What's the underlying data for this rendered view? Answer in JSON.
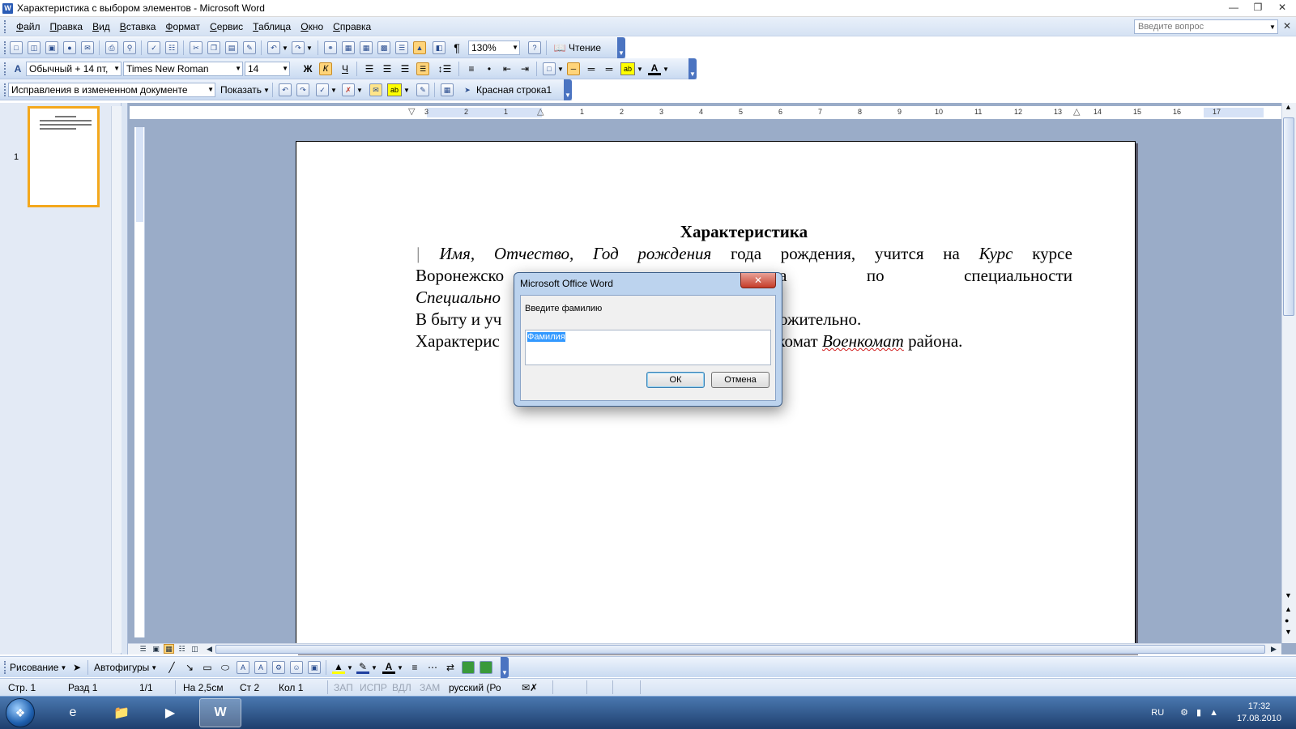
{
  "window": {
    "title": "Характеристика с выбором элементов - Microsoft Word",
    "app_icon": "word-icon"
  },
  "menu": {
    "items": [
      "Файл",
      "Правка",
      "Вид",
      "Вставка",
      "Формат",
      "Сервис",
      "Таблица",
      "Окно",
      "Справка"
    ],
    "ask_placeholder": "Введите вопрос"
  },
  "standard_toolbar": {
    "zoom": "130%",
    "reading_label": "Чтение"
  },
  "formatting_toolbar": {
    "style": "Обычный + 14 пт,",
    "font": "Times New Roman",
    "size": "14"
  },
  "review_toolbar": {
    "mode": "Исправления в измененном документе",
    "show_label": "Показать",
    "style_label": "Красная строка1"
  },
  "ruler": {
    "numbers": [
      "3",
      "2",
      "1",
      "1",
      "2",
      "3",
      "4",
      "5",
      "6",
      "7",
      "8",
      "9",
      "10",
      "11",
      "12",
      "13",
      "14",
      "15",
      "16",
      "17"
    ]
  },
  "thumbnail": {
    "page_number": "1"
  },
  "document": {
    "heading": "Характеристика",
    "line1_fields": [
      "Имя,",
      "Отчество,",
      "Год рождения"
    ],
    "line1_text": "года рождения, учится на",
    "course_field": "Курс",
    "course_text": "курсе",
    "line2_left": "Воронежско",
    "line2_right": "верситета по специальности",
    "line3_field": "Специально",
    "line4_left": "В быту и уч",
    "line4_right": "оложительно.",
    "line5_left": "Характерис",
    "line5_mid": "енкомат",
    "line5_field": "Военкомат",
    "line5_end": "района."
  },
  "dialog": {
    "title": "Microsoft Office Word",
    "prompt": "Введите фамилию",
    "input_value": "Фамилия",
    "ok": "ОК",
    "cancel": "Отмена"
  },
  "drawing_toolbar": {
    "draw_label": "Рисование",
    "autoshapes_label": "Автофигуры"
  },
  "status": {
    "page": "Стр. 1",
    "section": "Разд 1",
    "pages": "1/1",
    "at": "На 2,5см",
    "line": "Ст 2",
    "col": "Кол 1",
    "rec": "ЗАП",
    "trk": "ИСПР",
    "ext": "ВДЛ",
    "ovr": "ЗАМ",
    "lang": "русский (Ро"
  },
  "taskbar": {
    "lang": "RU",
    "time": "17:32",
    "date": "17.08.2010"
  }
}
